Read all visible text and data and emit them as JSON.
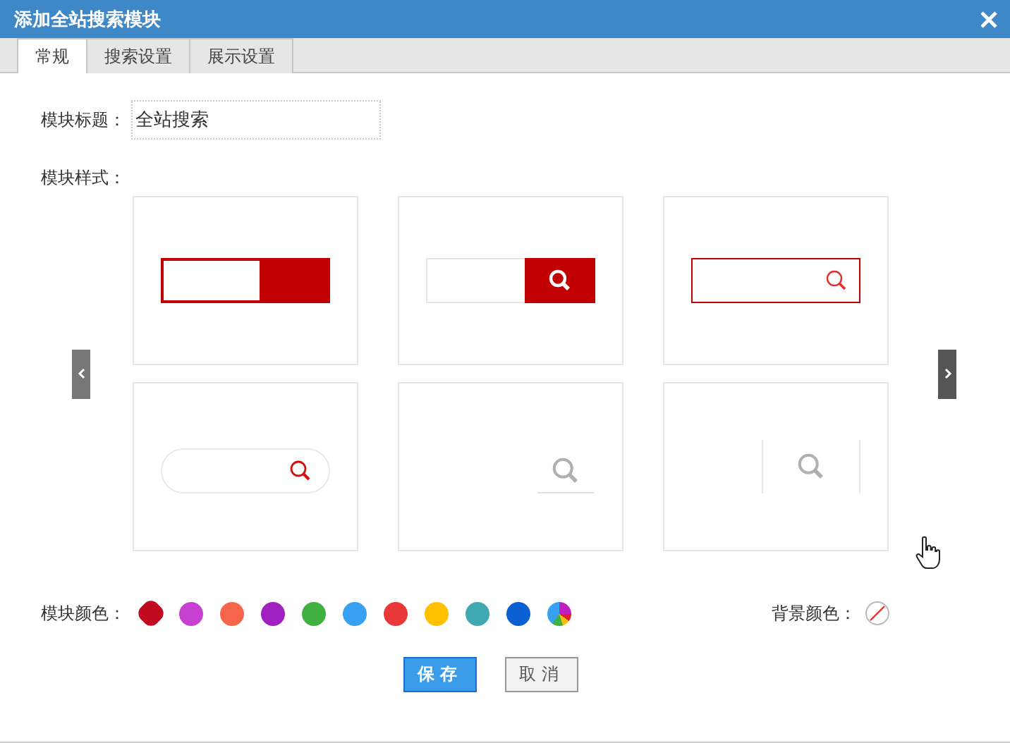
{
  "window": {
    "title": "添加全站搜索模块"
  },
  "tabs": [
    {
      "label": "常规",
      "selected": true
    },
    {
      "label": "搜索设置",
      "selected": false
    },
    {
      "label": "展示设置",
      "selected": false
    }
  ],
  "title_field": {
    "label": "模块标题：",
    "value": "全站搜索"
  },
  "styles": {
    "label": "模块样式：",
    "items": [
      {
        "kind": "solid"
      },
      {
        "kind": "button"
      },
      {
        "kind": "outlined"
      },
      {
        "kind": "rounded"
      },
      {
        "kind": "underline"
      },
      {
        "kind": "divided"
      }
    ]
  },
  "colors": {
    "label": "模块颜色：",
    "items": [
      {
        "kind": "plain",
        "color": "#c00a20",
        "selected": true
      },
      {
        "kind": "plain",
        "color": "#c840d0",
        "selected": false
      },
      {
        "kind": "plain",
        "color": "#f5654a",
        "selected": false
      },
      {
        "kind": "plain",
        "color": "#a020c0",
        "selected": false
      },
      {
        "kind": "plain",
        "color": "#40b040",
        "selected": false
      },
      {
        "kind": "plain",
        "color": "#38a0f0",
        "selected": false
      },
      {
        "kind": "plain",
        "color": "#e83838",
        "selected": false
      },
      {
        "kind": "plain",
        "color": "#ffc000",
        "selected": false
      },
      {
        "kind": "plain",
        "color": "#40a8b0",
        "selected": false
      },
      {
        "kind": "plain",
        "color": "#0a60d0",
        "selected": false
      },
      {
        "kind": "multi",
        "selected": false
      }
    ]
  },
  "background": {
    "label": "背景颜色："
  },
  "buttons": [
    {
      "label": "保存",
      "kind": "primary"
    },
    {
      "label": "取消",
      "kind": "secondary"
    }
  ]
}
